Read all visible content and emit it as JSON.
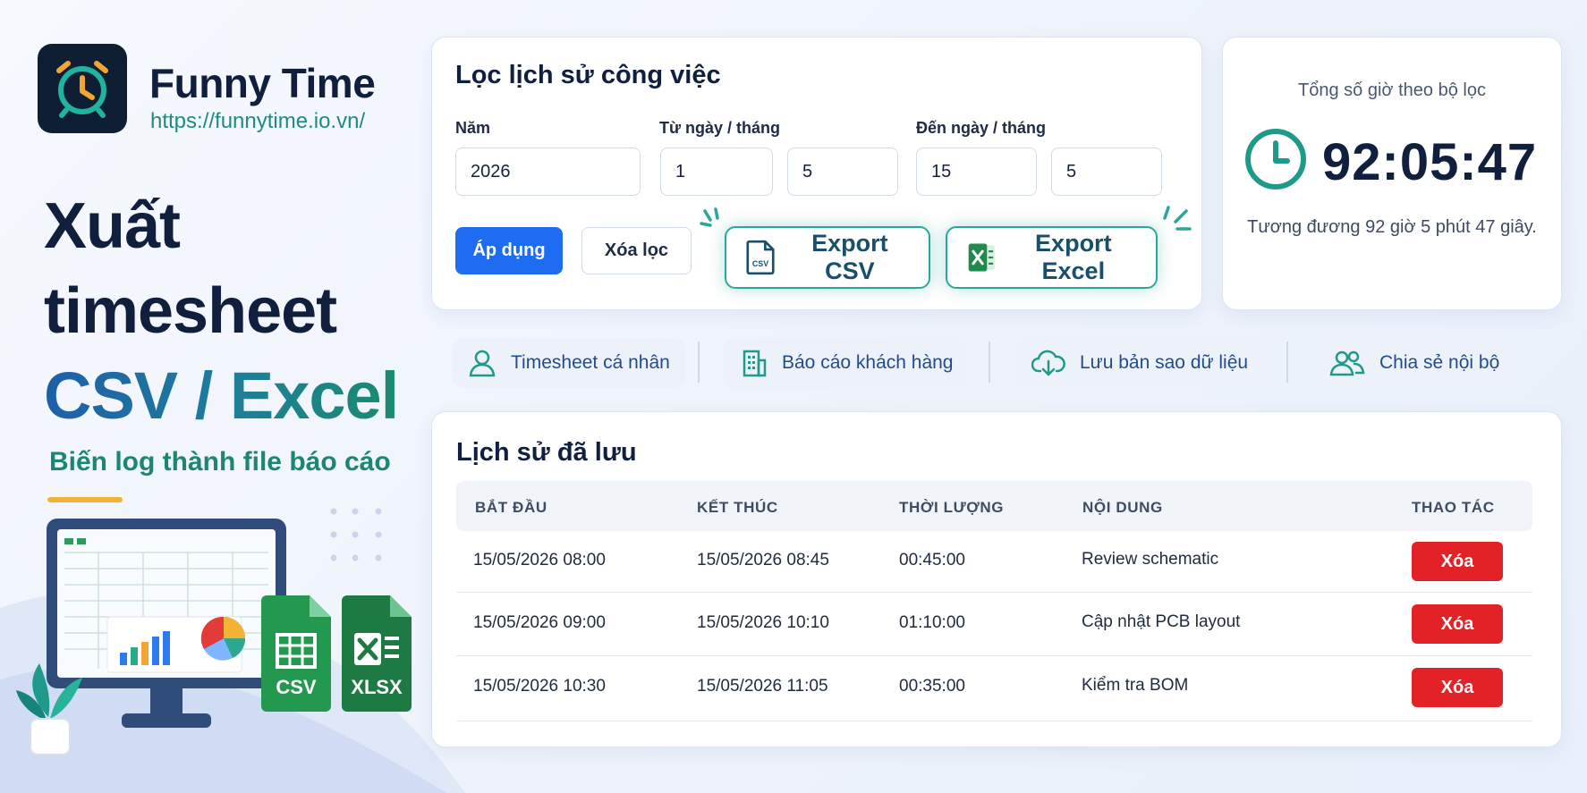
{
  "brand": {
    "name": "Funny Time",
    "url": "https://funnytime.io.vn/"
  },
  "hero": {
    "line1": "Xuất",
    "line2": "timesheet",
    "line3": "CSV / Excel",
    "subtitle": "Biến log thành file báo cáo",
    "file_badges": [
      "CSV",
      "XLSX"
    ]
  },
  "filter": {
    "title": "Lọc lịch sử công việc",
    "year_label": "Năm",
    "from_label": "Từ ngày / tháng",
    "to_label": "Đến ngày / tháng",
    "year_value": "2026",
    "from_day": "1",
    "from_month": "5",
    "to_day": "15",
    "to_month": "5",
    "apply_label": "Áp dụng",
    "clear_label": "Xóa lọc",
    "export_csv_label": "Export CSV",
    "export_excel_label": "Export Excel",
    "csv_icon_text": "CSV"
  },
  "total": {
    "caption": "Tổng số giờ theo bộ lọc",
    "value": "92:05:47",
    "subtext": "Tương đương 92 giờ 5 phút 47 giây."
  },
  "features": [
    {
      "label": "Timesheet cá nhân",
      "icon": "user-icon"
    },
    {
      "label": "Báo cáo khách hàng",
      "icon": "building-icon"
    },
    {
      "label": "Lưu bản sao dữ liệu",
      "icon": "cloud-download-icon"
    },
    {
      "label": "Chia sẻ nội bộ",
      "icon": "users-icon"
    }
  ],
  "history": {
    "title": "Lịch sử đã lưu",
    "columns": [
      "BẮT ĐẦU",
      "KẾT THÚC",
      "THỜI LƯỢNG",
      "NỘI DUNG",
      "THAO TÁC"
    ],
    "rows": [
      {
        "start": "15/05/2026 08:00",
        "end": "15/05/2026 08:45",
        "duration": "00:45:00",
        "content": "Review schematic",
        "action": "Xóa"
      },
      {
        "start": "15/05/2026 09:00",
        "end": "15/05/2026 10:10",
        "duration": "01:10:00",
        "content": "Cập nhật PCB layout",
        "action": "Xóa"
      },
      {
        "start": "15/05/2026 10:30",
        "end": "15/05/2026 11:05",
        "duration": "00:35:00",
        "content": "Kiểm tra BOM",
        "action": "Xóa"
      }
    ]
  },
  "colors": {
    "accent_blue": "#1e6cf0",
    "accent_teal": "#2aa79b",
    "danger_red": "#e32227",
    "highlight_yellow": "#f2b234"
  }
}
